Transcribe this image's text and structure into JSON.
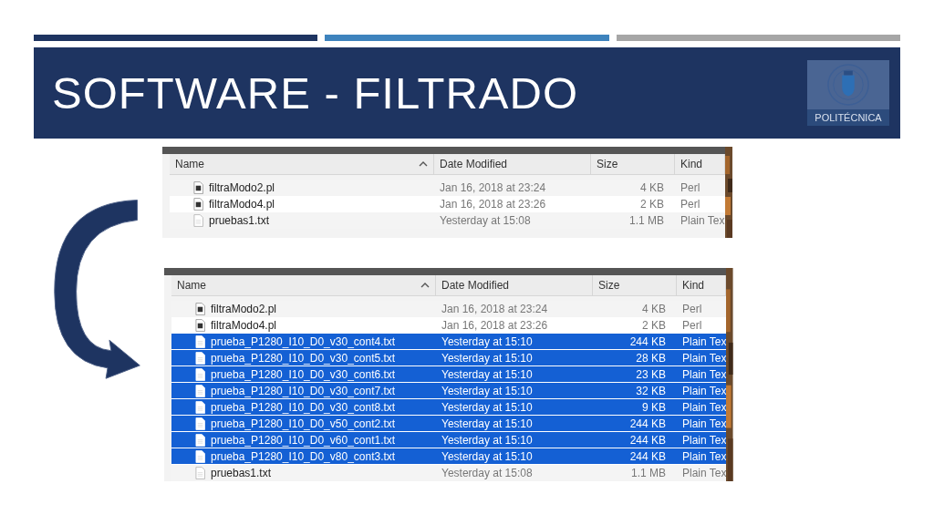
{
  "slide": {
    "title": "SOFTWARE - FILTRADO",
    "logo": {
      "text": "POLITÉCNICA"
    }
  },
  "lists": [
    {
      "columns": [
        {
          "label": "Name",
          "sorted": true
        },
        {
          "label": "Date Modified",
          "sorted": false
        },
        {
          "label": "Size",
          "sorted": false
        },
        {
          "label": "Kind",
          "sorted": false
        }
      ],
      "rows": [
        {
          "kind": "perl",
          "name": "filtraModo2.pl",
          "date": "Jan 16, 2018 at 23:24",
          "size": "4 KB",
          "type": "Perl",
          "selected": false
        },
        {
          "kind": "perl",
          "name": "filtraModo4.pl",
          "date": "Jan 16, 2018 at 23:26",
          "size": "2 KB",
          "type": "Perl",
          "selected": false
        },
        {
          "kind": "text",
          "name": "pruebas1.txt",
          "date": "Yesterday at 15:08",
          "size": "1.1 MB",
          "type": "Plain Tex",
          "selected": false
        }
      ]
    },
    {
      "columns": [
        {
          "label": "Name",
          "sorted": true
        },
        {
          "label": "Date Modified",
          "sorted": false
        },
        {
          "label": "Size",
          "sorted": false
        },
        {
          "label": "Kind",
          "sorted": false
        }
      ],
      "rows": [
        {
          "kind": "perl",
          "name": "filtraModo2.pl",
          "date": "Jan 16, 2018 at 23:24",
          "size": "4 KB",
          "type": "Perl",
          "selected": false
        },
        {
          "kind": "perl",
          "name": "filtraModo4.pl",
          "date": "Jan 16, 2018 at 23:26",
          "size": "2 KB",
          "type": "Perl",
          "selected": false
        },
        {
          "kind": "text",
          "name": "prueba_P1280_I10_D0_v30_cont4.txt",
          "date": "Yesterday at 15:10",
          "size": "244 KB",
          "type": "Plain Tex",
          "selected": true
        },
        {
          "kind": "text",
          "name": "prueba_P1280_I10_D0_v30_cont5.txt",
          "date": "Yesterday at 15:10",
          "size": "28 KB",
          "type": "Plain Tex",
          "selected": true
        },
        {
          "kind": "text",
          "name": "prueba_P1280_I10_D0_v30_cont6.txt",
          "date": "Yesterday at 15:10",
          "size": "23 KB",
          "type": "Plain Tex",
          "selected": true
        },
        {
          "kind": "text",
          "name": "prueba_P1280_I10_D0_v30_cont7.txt",
          "date": "Yesterday at 15:10",
          "size": "32 KB",
          "type": "Plain Tex",
          "selected": true
        },
        {
          "kind": "text",
          "name": "prueba_P1280_I10_D0_v30_cont8.txt",
          "date": "Yesterday at 15:10",
          "size": "9 KB",
          "type": "Plain Tex",
          "selected": true
        },
        {
          "kind": "text",
          "name": "prueba_P1280_I10_D0_v50_cont2.txt",
          "date": "Yesterday at 15:10",
          "size": "244 KB",
          "type": "Plain Tex",
          "selected": true
        },
        {
          "kind": "text",
          "name": "prueba_P1280_I10_D0_v60_cont1.txt",
          "date": "Yesterday at 15:10",
          "size": "244 KB",
          "type": "Plain Tex",
          "selected": true
        },
        {
          "kind": "text",
          "name": "prueba_P1280_I10_D0_v80_cont3.txt",
          "date": "Yesterday at 15:10",
          "size": "244 KB",
          "type": "Plain Tex",
          "selected": true
        },
        {
          "kind": "text",
          "name": "pruebas1.txt",
          "date": "Yesterday at 15:08",
          "size": "1.1 MB",
          "type": "Plain Tex",
          "selected": false
        }
      ]
    }
  ]
}
